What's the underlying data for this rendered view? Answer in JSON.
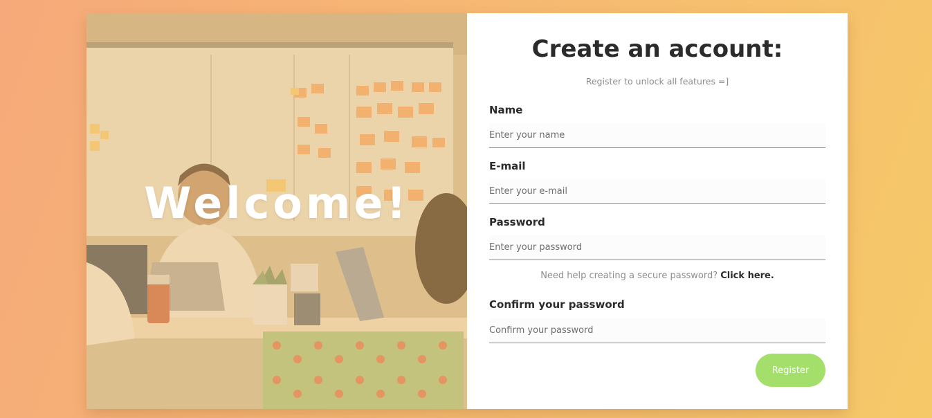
{
  "hero": {
    "welcome": "Welcome!"
  },
  "form": {
    "title": "Create an account:",
    "subtitle": "Register to unlock all features =]",
    "name_label": "Name",
    "name_placeholder": "Enter your name",
    "email_label": "E-mail",
    "email_placeholder": "Enter your e-mail",
    "password_label": "Password",
    "password_placeholder": "Enter your password",
    "help_text": "Need help creating a secure password?",
    "help_link": "Click here.",
    "confirm_label": "Confirm your password",
    "confirm_placeholder": "Confirm your password",
    "register_label": "Register"
  },
  "colors": {
    "accent": "#a3df6a",
    "title": "#2b2b2b",
    "muted": "#8c8c8c"
  }
}
